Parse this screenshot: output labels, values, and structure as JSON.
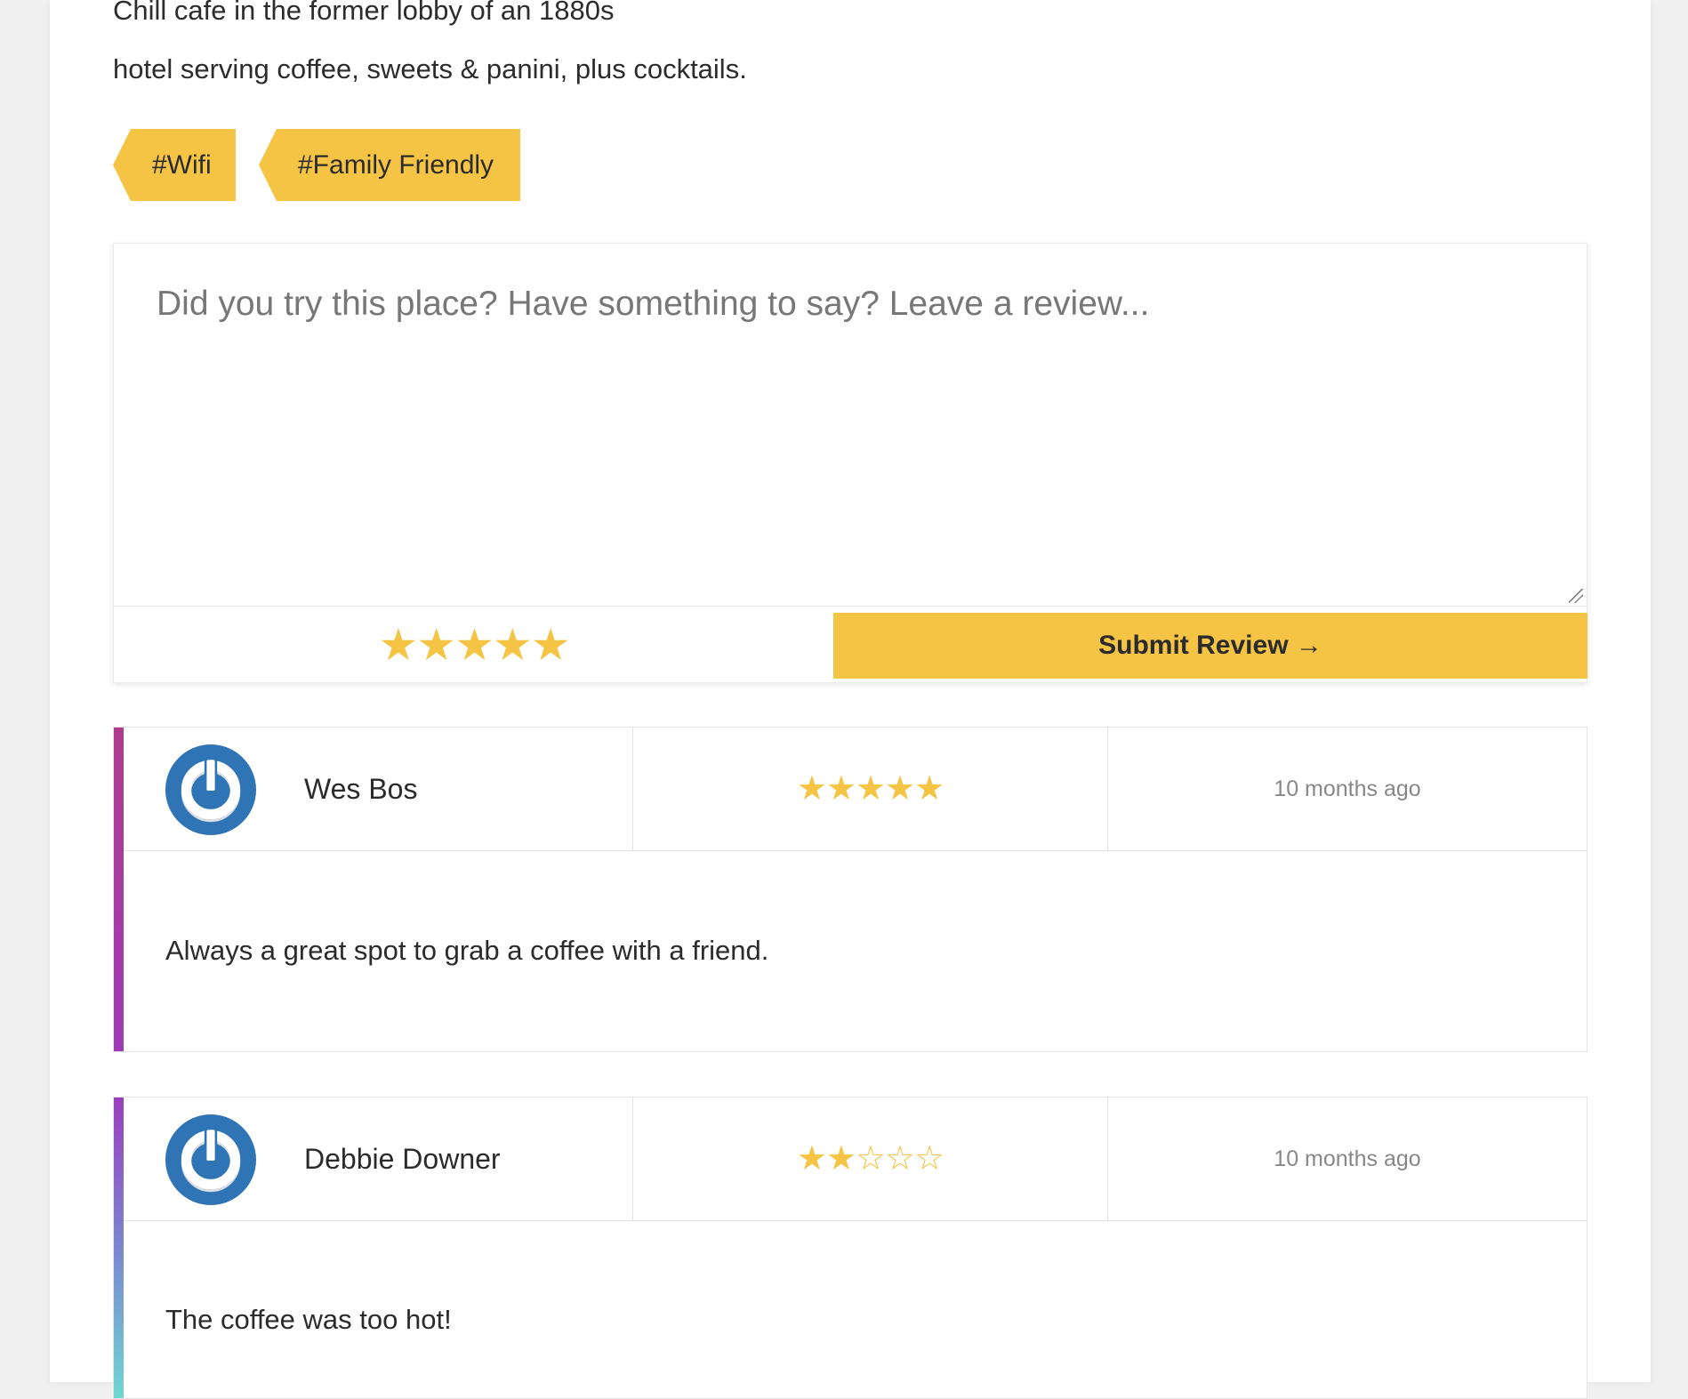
{
  "store": {
    "description_line_1": "Chill cafe in the former lobby of an 1880s",
    "description_line_2": "hotel serving coffee, sweets & panini, plus cocktails.",
    "tags": [
      "#Wifi",
      "#Family Friendly"
    ]
  },
  "review_form": {
    "placeholder": "Did you try this place? Have something to say? Leave a review...",
    "rating": 5,
    "rating_stars": "★★★★★",
    "submit_label": "Submit Review →"
  },
  "reviews": [
    {
      "author": "Wes Bos",
      "avatar_icon": "gravatar-power-icon",
      "rating": 5,
      "stars": "★★★★★",
      "time": "10 months ago",
      "text": "Always a great spot to grab a coffee with a friend."
    },
    {
      "author": "Debbie Downer",
      "avatar_icon": "gravatar-power-icon",
      "rating": 2,
      "stars": "★★☆☆☆",
      "time": "10 months ago",
      "text": "The coffee was too hot!"
    }
  ],
  "colors": {
    "accent": "#f6c445",
    "avatar_blue": "#2f74b5",
    "text": "#2b2b2b",
    "muted": "#888888"
  }
}
